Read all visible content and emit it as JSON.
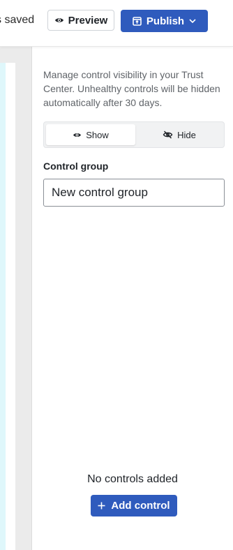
{
  "header": {
    "save_status": "s saved",
    "preview_label": "Preview",
    "publish_label": "Publish"
  },
  "panel": {
    "description": "Manage control visibility in your Trust Center. Unhealthy controls will be hidden automatically after 30 days.",
    "visibility_toggle": {
      "show_label": "Show",
      "hide_label": "Hide",
      "selected": "Show"
    },
    "control_group": {
      "label": "Control group",
      "value": "New control group"
    },
    "empty_state": {
      "message": "No controls added",
      "add_label": "Add control"
    }
  },
  "colors": {
    "primary": "#2f5bbd",
    "canvas_bg": "#ebebeb",
    "canvas_accent": "#dff7fb"
  },
  "icons": {
    "preview": "eye-icon",
    "publish": "publish-icon",
    "publish_menu": "chevron-down-icon",
    "show": "eye-icon",
    "hide": "eye-off-icon",
    "add": "plus-icon"
  }
}
